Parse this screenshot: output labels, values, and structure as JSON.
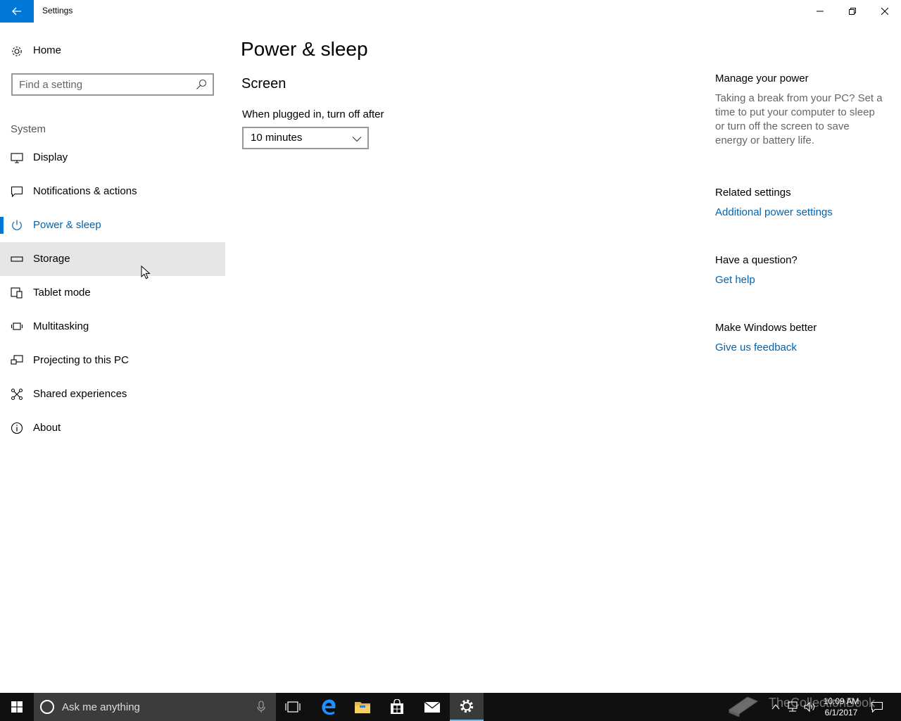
{
  "window": {
    "title": "Settings",
    "accent_color": "#0078d7"
  },
  "sidebar": {
    "home_label": "Home",
    "search_placeholder": "Find a setting",
    "section_label": "System",
    "items": [
      {
        "label": "Display",
        "icon": "monitor-icon",
        "active": false
      },
      {
        "label": "Notifications & actions",
        "icon": "notification-icon",
        "active": false
      },
      {
        "label": "Power & sleep",
        "icon": "power-icon",
        "active": true
      },
      {
        "label": "Storage",
        "icon": "storage-icon",
        "active": false,
        "hover": true
      },
      {
        "label": "Tablet mode",
        "icon": "tablet-mode-icon",
        "active": false
      },
      {
        "label": "Multitasking",
        "icon": "multitasking-icon",
        "active": false
      },
      {
        "label": "Projecting to this PC",
        "icon": "projecting-icon",
        "active": false
      },
      {
        "label": "Shared experiences",
        "icon": "shared-experiences-icon",
        "active": false
      },
      {
        "label": "About",
        "icon": "info-icon",
        "active": false
      }
    ]
  },
  "main": {
    "page_title": "Power & sleep",
    "section_title": "Screen",
    "plugged_in_label": "When plugged in, turn off after",
    "plugged_in_value": "10 minutes"
  },
  "aside": {
    "manage_title": "Manage your power",
    "manage_text": "Taking a break from your PC? Set a time to put your computer to sleep or turn off the screen to save energy or battery life.",
    "related_title": "Related settings",
    "related_link": "Additional power settings",
    "question_title": "Have a question?",
    "question_link": "Get help",
    "feedback_title": "Make Windows better",
    "feedback_link": "Give us feedback"
  },
  "taskbar": {
    "search_text": "Ask me anything",
    "time": "10:09 AM",
    "date": "6/1/2017",
    "watermark": "TheCollectionBook",
    "pinned": [
      "task-view-icon",
      "edge-icon",
      "file-explorer-icon",
      "store-icon",
      "mail-icon",
      "settings-icon"
    ]
  }
}
